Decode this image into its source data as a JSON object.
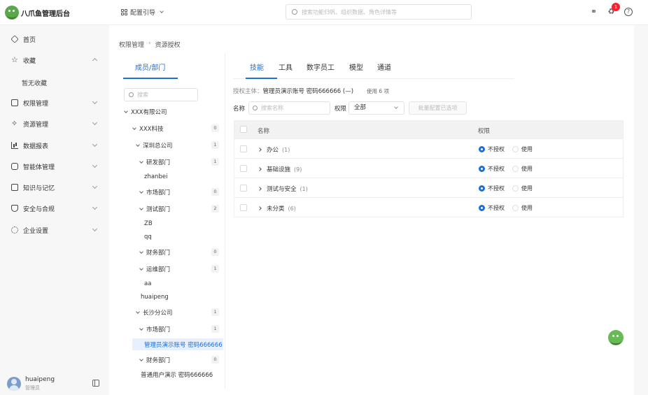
{
  "app": {
    "title": "八爪鱼管理后台"
  },
  "header": {
    "config_guide": "配置引导",
    "search_placeholder": "搜索功能归帆、组织数据、角色详情等",
    "notification_count": "1"
  },
  "sidebar": {
    "items": [
      {
        "label": "首页",
        "icon": "home-icon"
      },
      {
        "label": "收藏",
        "icon": "star-icon",
        "expanded": true
      },
      {
        "label": "权限管理",
        "icon": "key-icon"
      },
      {
        "label": "资源管理",
        "icon": "resource-icon"
      },
      {
        "label": "数据报表",
        "icon": "bar-chart-icon"
      },
      {
        "label": "智能体管理",
        "icon": "robot-icon"
      },
      {
        "label": "知识与记忆",
        "icon": "book-icon"
      },
      {
        "label": "安全与合规",
        "icon": "shield-icon"
      },
      {
        "label": "企业设置",
        "icon": "gear-icon"
      }
    ],
    "favorites_empty": "暂无收藏"
  },
  "user": {
    "name": "huaipeng",
    "role": "管理员"
  },
  "breadcrumb": [
    "权限管理",
    "资源授权"
  ],
  "left_panel": {
    "tab": "成员/部门",
    "search_placeholder": "搜索",
    "tree": [
      {
        "label": "XXX有限公司"
      },
      {
        "label": "XXX科技",
        "count": "0"
      },
      {
        "label": "深圳总公司",
        "count": "1"
      },
      {
        "label": "研发部门",
        "count": "1"
      },
      {
        "label": "zhanbei"
      },
      {
        "label": "市场部门",
        "count": "0"
      },
      {
        "label": "测试部门",
        "count": "2"
      },
      {
        "label": "ZB"
      },
      {
        "label": "qq"
      },
      {
        "label": "财务部门",
        "count": "0"
      },
      {
        "label": "运维部门",
        "count": "1"
      },
      {
        "label": "aa"
      },
      {
        "label": "huaipeng"
      },
      {
        "label": "长沙分公司",
        "count": "1"
      },
      {
        "label": "市场部门",
        "count": "1"
      },
      {
        "label": "管理员演示账号 密码666666",
        "selected": true
      },
      {
        "label": "财务部门",
        "count": "0"
      },
      {
        "label": "普通用户演示 密码666666"
      }
    ]
  },
  "tabs": [
    "技能",
    "工具",
    "数字员工",
    "模型",
    "通道"
  ],
  "subject": {
    "label": "授权主体：",
    "value": "管理员演示账号 密码666666",
    "suffix": "(—)",
    "usage": "使用 6 项"
  },
  "filters": {
    "name_label": "名称",
    "name_placeholder": "搜索名称",
    "perm_label": "权限",
    "perm_value": "全部",
    "batch_button": "批量配置已选项"
  },
  "table": {
    "headers": [
      "名称",
      "权限"
    ],
    "rows": [
      {
        "name": "办公",
        "count": "(1)",
        "unauth": "不授权",
        "use": "使用"
      },
      {
        "name": "基础设施",
        "count": "(9)",
        "unauth": "不授权",
        "use": "使用"
      },
      {
        "name": "测试与安全",
        "count": "(1)",
        "unauth": "不授权",
        "use": "使用"
      },
      {
        "name": "未分类",
        "count": "(6)",
        "unauth": "不授权",
        "use": "使用"
      }
    ]
  },
  "colors": {
    "accent": "#1a6fd8",
    "sidebar_bg": "#f7f7f8",
    "badge": "#f5222d",
    "brand": "#5aa84a"
  }
}
